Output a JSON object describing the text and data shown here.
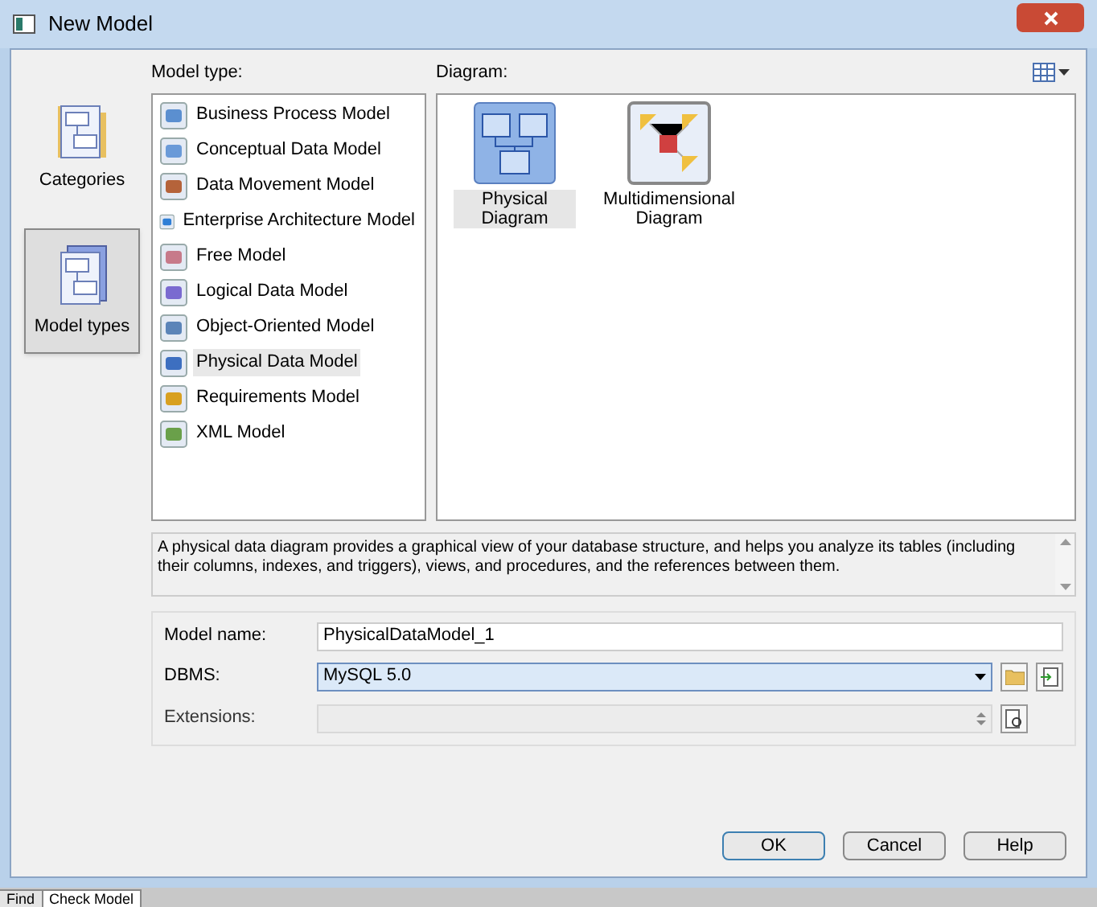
{
  "window": {
    "title": "New Model"
  },
  "categories": [
    {
      "label": "Categories",
      "selected": false
    },
    {
      "label": "Model types",
      "selected": true
    }
  ],
  "model_type": {
    "label": "Model type:",
    "items": [
      {
        "label": "Business Process Model",
        "selected": false
      },
      {
        "label": "Conceptual Data Model",
        "selected": false
      },
      {
        "label": "Data Movement Model",
        "selected": false
      },
      {
        "label": "Enterprise Architecture Model",
        "selected": false
      },
      {
        "label": "Free Model",
        "selected": false
      },
      {
        "label": "Logical Data Model",
        "selected": false
      },
      {
        "label": "Object-Oriented Model",
        "selected": false
      },
      {
        "label": "Physical Data Model",
        "selected": true
      },
      {
        "label": "Requirements Model",
        "selected": false
      },
      {
        "label": "XML Model",
        "selected": false
      }
    ]
  },
  "diagram": {
    "label": "Diagram:",
    "items": [
      {
        "label": "Physical Diagram",
        "kind": "physical",
        "selected": true
      },
      {
        "label": "Multidimensional Diagram",
        "kind": "multidimensional",
        "selected": false
      }
    ]
  },
  "description": "A physical data diagram provides a graphical view of your database structure, and helps you analyze its tables (including their columns, indexes, and triggers), views, and procedures, and the references between them.",
  "form": {
    "model_name": {
      "label": "Model name:",
      "value": "PhysicalDataModel_1"
    },
    "dbms": {
      "label": "DBMS:",
      "value": "MySQL 5.0"
    },
    "extensions": {
      "label": "Extensions:",
      "disabled": true
    }
  },
  "buttons": [
    {
      "label": "OK",
      "default": true
    },
    {
      "label": "Cancel",
      "default": false
    },
    {
      "label": "Help",
      "default": false
    }
  ],
  "bottom_tabs": [
    {
      "label": "Find",
      "selected": false
    },
    {
      "label": "Check Model",
      "selected": true
    }
  ]
}
